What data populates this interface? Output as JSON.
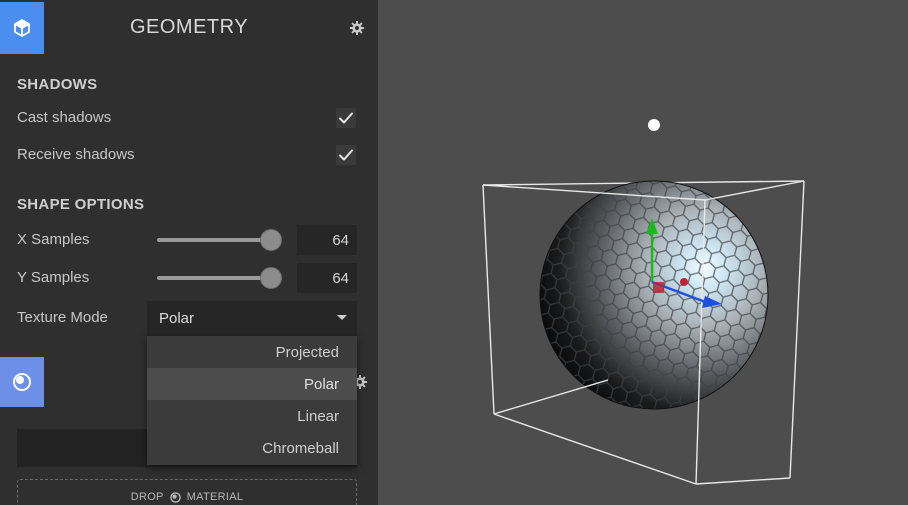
{
  "panel": {
    "title": "GEOMETRY",
    "geometry_tab_icon": "cube-icon",
    "material_tab_icon": "sphere-icon",
    "settings_icon": "gear-icon",
    "accent_color": "#4a8ff0"
  },
  "shadows": {
    "section_title": "SHADOWS",
    "cast_label": "Cast shadows",
    "cast_checked": true,
    "receive_label": "Receive shadows",
    "receive_checked": true
  },
  "shape_options": {
    "section_title": "SHAPE OPTIONS",
    "x_samples_label": "X Samples",
    "x_samples_value": "64",
    "x_samples_fraction": 1.0,
    "y_samples_label": "Y Samples",
    "y_samples_value": "64",
    "y_samples_fraction": 1.0,
    "texture_mode_label": "Texture Mode",
    "texture_mode_value": "Polar",
    "texture_mode_options": [
      "Projected",
      "Polar",
      "Linear",
      "Chromeball"
    ],
    "texture_mode_selected_index": 1
  },
  "material": {
    "drop_label_left": "DROP",
    "drop_label_right": "MATERIAL",
    "drop_icon": "material-sphere-icon"
  },
  "viewport": {
    "background_color": "#4d4d4d",
    "object": "hex-textured-sphere",
    "gizmo_axes": [
      "y-green",
      "x-blue",
      "z-red"
    ],
    "light_icon": "point-light-icon"
  }
}
